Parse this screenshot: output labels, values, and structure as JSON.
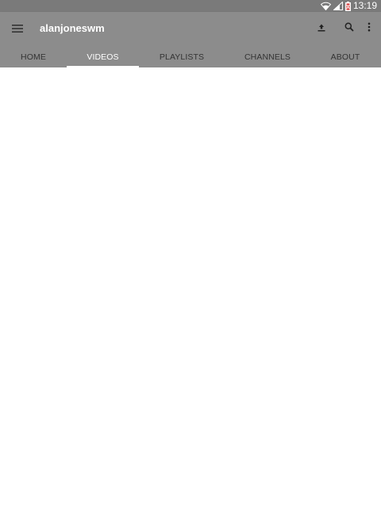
{
  "status_bar": {
    "time": "13:19",
    "icons": [
      "wifi-icon",
      "cell-signal-icon",
      "battery-icon"
    ]
  },
  "app_bar": {
    "title": "alanjoneswm",
    "menu_icon": "hamburger-menu-icon",
    "actions": [
      "upload-icon",
      "search-icon",
      "more-vert-icon"
    ]
  },
  "tabs": [
    {
      "label": "HOME",
      "active": false
    },
    {
      "label": "VIDEOS",
      "active": true
    },
    {
      "label": "PLAYLISTS",
      "active": false
    },
    {
      "label": "CHANNELS",
      "active": false
    },
    {
      "label": "ABOUT",
      "active": false
    }
  ],
  "colors": {
    "status_bar": "#7a7a7a",
    "app_bar": "#8c8c8c",
    "active_tab_text": "#ffffff",
    "inactive_tab_text": "#333333",
    "background": "#ffffff"
  }
}
